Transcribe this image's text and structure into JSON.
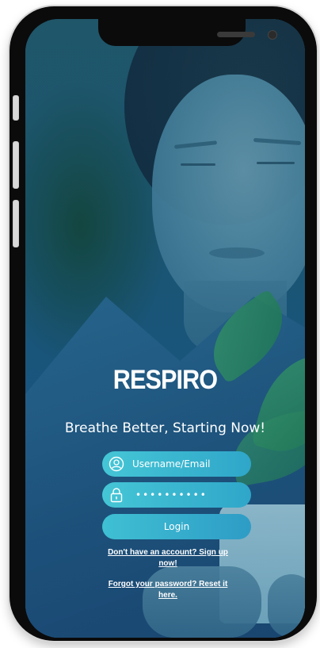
{
  "app": {
    "logo": "RESPIRO",
    "tagline": "Breathe Better, Starting Now!"
  },
  "login_form": {
    "username_placeholder": "Username/Email",
    "password_value": "••••••••••",
    "login_label": "Login"
  },
  "links": {
    "signup": "Don't have an account? Sign up now!",
    "forgot_password": "Forgot your password? Reset it here."
  },
  "colors": {
    "field_fill": "#37b6d0",
    "text": "#ffffff",
    "screen_tint": "#1d5a78"
  },
  "icons": {
    "username": "user-circle-icon",
    "password": "lock-icon"
  }
}
